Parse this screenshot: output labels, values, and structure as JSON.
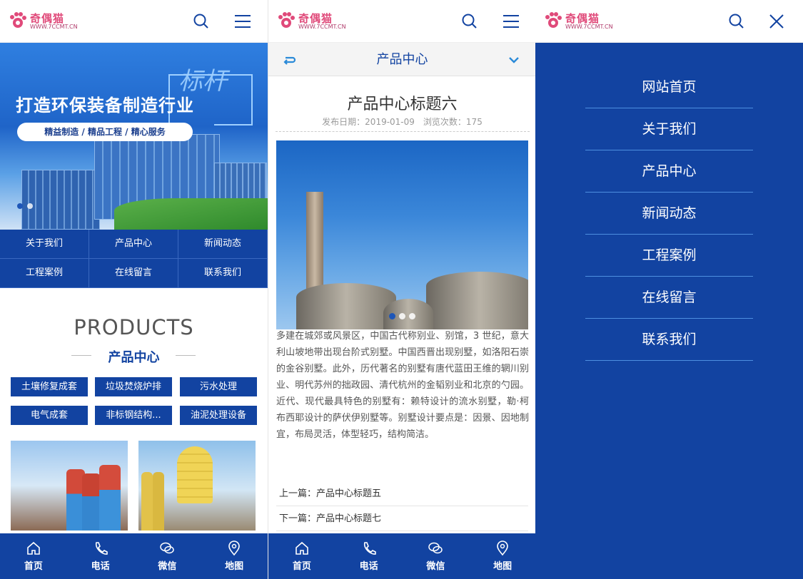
{
  "brand": {
    "logo_text": "奇偶猫",
    "logo_sub": "WWW.7CCMT.CN",
    "primary_color": "#1243a1",
    "accent_color": "#e04a7a"
  },
  "panel1": {
    "banner": {
      "headline": "打造环保装备制造行业",
      "tagline": "精益制造 / 精品工程 / 精心服务",
      "badge": "标杆"
    },
    "nav_grid": [
      "关于我们",
      "产品中心",
      "新闻动态",
      "工程案例",
      "在线留言",
      "联系我们"
    ],
    "products_en": "PRODUCTS",
    "products_cn": "产品中心",
    "categories": [
      "土壤修复成套",
      "垃圾焚烧炉排",
      "污水处理",
      "电气成套",
      "非标钢结构...",
      "油泥处理设备"
    ]
  },
  "panel2": {
    "sub_title": "产品中心",
    "article_title": "产品中心标题六",
    "date_label": "发布日期：2019-01-09",
    "views_label": "浏览次数：175",
    "body": "多建在城郊或风景区，中国古代称别业、别馆，3 世纪，意大利山坡地带出现台阶式别墅。中国西晋出现别墅，如洛阳石崇的金谷别墅。此外，历代著名的别墅有唐代蓝田王维的辋川别业、明代苏州的拙政园、清代杭州的金韬别业和北京的勺园。近代、现代最具特色的别墅有：赖特设计的流水别墅，勒·柯布西耶设计的萨伏伊别墅等。别墅设计要点是：因景、因地制宜，布局灵活，体型轻巧，结构简洁。",
    "prev": "上一篇：产品中心标题五",
    "next": "下一篇：产品中心标题七"
  },
  "panel3": {
    "menu": [
      "网站首页",
      "关于我们",
      "产品中心",
      "新闻动态",
      "工程案例",
      "在线留言",
      "联系我们"
    ]
  },
  "bottom_nav": [
    {
      "label": "首页",
      "icon": "home-icon"
    },
    {
      "label": "电话",
      "icon": "phone-icon"
    },
    {
      "label": "微信",
      "icon": "wechat-icon"
    },
    {
      "label": "地图",
      "icon": "map-pin-icon"
    }
  ]
}
